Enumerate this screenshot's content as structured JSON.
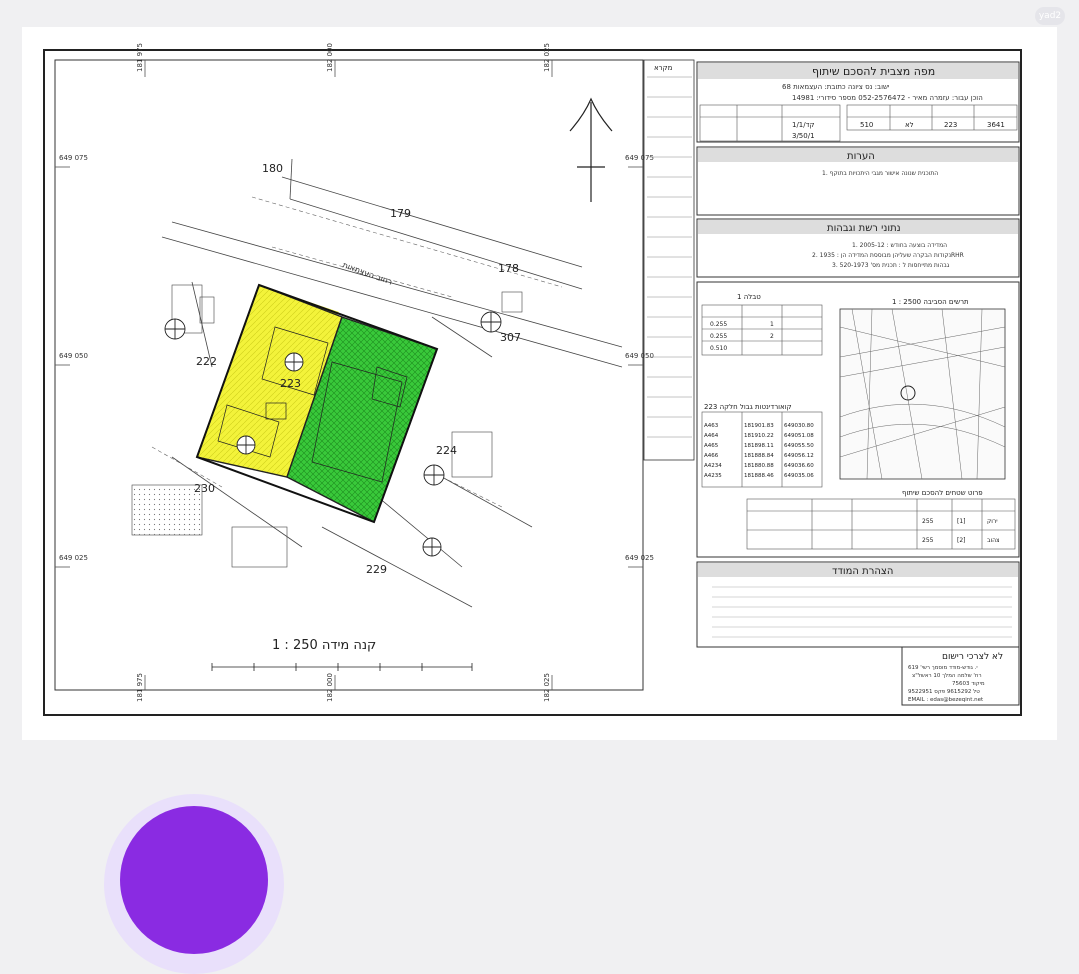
{
  "map": {
    "title": "מפה מצבית להסכם שיתוף",
    "address_line1": "ישוב: נס ציונה  כתובת: העצמאות 68",
    "address_line2": "הוכן עבור: עזמרה מאיר - 052-2576472  מספר סידורי: 14981",
    "scale_label": "קנה מידה  250 : 1",
    "notes_header": "הערות",
    "notes_line1": "1. התוכנית שנונה אישור מגבי היתכויות בתוקף",
    "survey_header": "נתוני רשת וגבהות",
    "survey_lines": [
      "1. המדידה בוצעה בחודש : 2005-12",
      "2. נקודות הבקרה שעליהן מבוססת המדידה הן : 1935RHR",
      "3. גבהות מתייחסות ל : תכנית מס' 520-1973"
    ],
    "declaration_header": "הצהרת המודד",
    "legend_title": "מקרא",
    "location_title": "תרשים הסביבה 2500 : 1",
    "table1_title": "טבלה 1",
    "coords_title": "קואורדינטות גבול חלקה 223",
    "agreement_title": "פרוט שטחים להסכם שיתוף",
    "grid_labels": [
      "649 075",
      "649 050",
      "649 025"
    ],
    "top_labels": [
      "181 975",
      "182 000",
      "182 025"
    ],
    "parcel_numbers": [
      "180",
      "179",
      "178",
      "222",
      "223",
      "307",
      "224",
      "230",
      "229"
    ],
    "street_label": "רחוב העצמאות",
    "office_title": "לא לצרכי רישום",
    "office_lines": [
      "י. גודש-מודד מוסמך רשי' 619",
      "רח' שלמה המלך 10 ראשל\"צ",
      "מיקוד 75603",
      "טל 9615292  פקס 9522951",
      "EMAIL : edas@bezeqint.net"
    ],
    "plan_values": [
      "1/1/קד",
      "3/50/1"
    ],
    "block_values": [
      "3641",
      "223",
      "לא",
      "510"
    ],
    "table1_values": [
      [
        "1",
        "0.255"
      ],
      [
        "2",
        "0.255"
      ],
      [
        "",
        "0.510"
      ]
    ],
    "coords_rows": [
      [
        "A463",
        "181901.83",
        "649030.80"
      ],
      [
        "A464",
        "181910.22",
        "649051.08"
      ],
      [
        "A465",
        "181898.11",
        "649055.50"
      ],
      [
        "A466",
        "181888.84",
        "649056.12"
      ],
      [
        "A4234",
        "181880.88",
        "649036.60"
      ],
      [
        "A4235",
        "181888.46",
        "649035.06"
      ]
    ],
    "agreement_rows": [
      [
        "ירוק",
        "[1]",
        "255"
      ],
      [
        "צהוב",
        "[2]",
        "255"
      ]
    ]
  },
  "colors": {
    "yellow_lot": "#f5f53c",
    "green_lot": "#3ccc3c",
    "border": "#222222"
  }
}
